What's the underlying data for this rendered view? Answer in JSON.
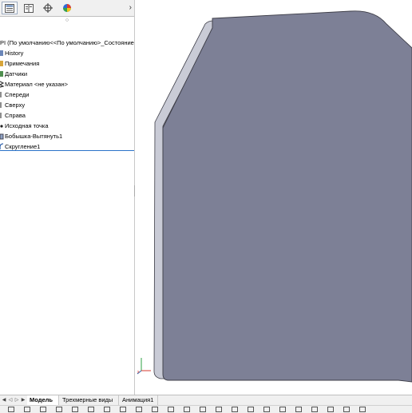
{
  "feature_tree": {
    "root_label": "PI  (По умолчанию<<По умолчанию>_Состояние о",
    "items": [
      {
        "label": "History",
        "icon": "history-icon"
      },
      {
        "label": "Примечания",
        "icon": "annotations-icon"
      },
      {
        "label": "Датчики",
        "icon": "sensors-icon"
      },
      {
        "label": "Материал <не указан>",
        "icon": "material-icon"
      },
      {
        "label": "Спереди",
        "icon": "plane-icon"
      },
      {
        "label": "Сверху",
        "icon": "plane-icon"
      },
      {
        "label": "Справа",
        "icon": "plane-icon"
      },
      {
        "label": "Исходная точка",
        "icon": "origin-icon"
      },
      {
        "label": "Бобышка-Вытянуть1",
        "icon": "extrude-icon"
      },
      {
        "label": "Скругление1",
        "icon": "fillet-icon"
      }
    ]
  },
  "bottom_tabs": [
    {
      "label": "Модель",
      "active": true
    },
    {
      "label": "Трехмерные виды",
      "active": false
    },
    {
      "label": "Анимация1",
      "active": false
    }
  ],
  "colors": {
    "model_face": "#7d8096",
    "model_edge": "#c9cbd6",
    "model_outline": "#3c3c46",
    "selection_line": "#2b73c9"
  }
}
